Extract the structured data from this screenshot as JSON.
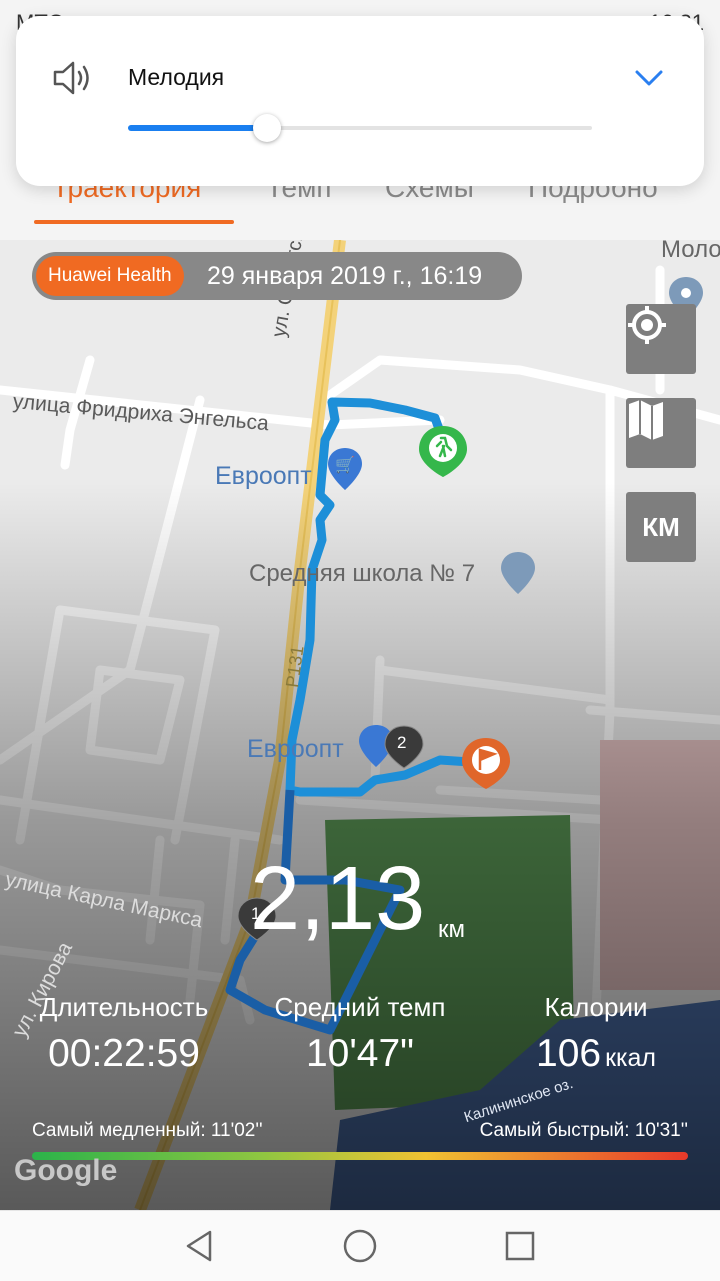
{
  "status_bar": {
    "left": "МТС",
    "time": "16:31"
  },
  "volume_popup": {
    "label": "Мелодия",
    "level": 0.3,
    "speaker_icon": "speaker-icon",
    "expand_icon": "chevron-down-icon"
  },
  "tabs": [
    {
      "label": "Траектория",
      "active": true
    },
    {
      "label": "Темп",
      "active": false
    },
    {
      "label": "Схемы",
      "active": false
    },
    {
      "label": "Подробно",
      "active": false
    }
  ],
  "source": {
    "app": "Huawei Health",
    "datetime": "29 января 2019 г., 16:19"
  },
  "map": {
    "streets": [
      "ул. Советская",
      "улица Фридриха Энгельса",
      "улица Карла Маркса",
      "ул. Кирова",
      "Р131",
      "Калининское оз."
    ],
    "places": [
      "Евроопт",
      "Евроопт",
      "Средняя школа № 7",
      "Моло"
    ],
    "markers": {
      "start": "walk-icon",
      "finish": "flag-icon",
      "km1": "1",
      "km2": "2"
    },
    "controls": {
      "locate": "locate-icon",
      "layers": "map-icon",
      "units": "КМ"
    },
    "attribution": "Google"
  },
  "summary": {
    "distance": "2,13",
    "distance_unit": "км"
  },
  "stats": [
    {
      "label": "Длительность",
      "value": "00:22:59",
      "unit": ""
    },
    {
      "label": "Средний темп",
      "value": "10'47\"",
      "unit": ""
    },
    {
      "label": "Калории",
      "value": "106",
      "unit": "ккал"
    }
  ],
  "pace_bar": {
    "slowest": "Самый медленный: 11'02''",
    "fastest": "Самый быстрый: 10'31''",
    "colors": [
      "#2bb34a",
      "#f1c232",
      "#e8392a"
    ]
  },
  "nav": {
    "back": "back-icon",
    "home": "home-icon",
    "recents": "recents-icon"
  }
}
